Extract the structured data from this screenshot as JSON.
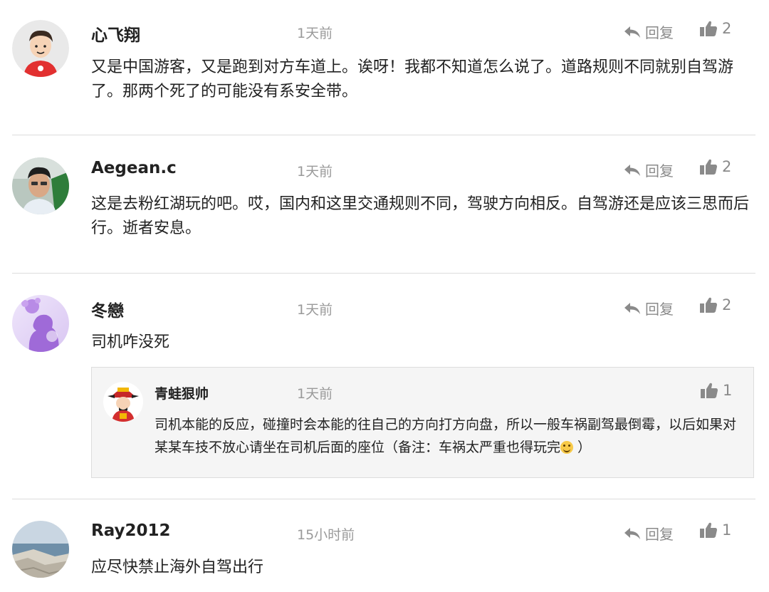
{
  "comments": [
    {
      "username": "心飞翔",
      "time": "1天前",
      "reply_label": "回复",
      "likes": "2",
      "text": "又是中国游客，又是跑到对方车道上。诶呀！我都不知道怎么说了。道路规则不同就别自驾游了。那两个死了的可能没有系安全带。"
    },
    {
      "username": "Aegean.c",
      "time": "1天前",
      "reply_label": "回复",
      "likes": "2",
      "text": "这是去粉红湖玩的吧。哎，国内和这里交通规则不同，驾驶方向相反。自驾游还是应该三思而后行。逝者安息。"
    },
    {
      "username": "冬戀",
      "time": "1天前",
      "reply_label": "回复",
      "likes": "2",
      "text": "司机咋没死",
      "reply": {
        "username": "青蛙狠帅",
        "time": "1天前",
        "likes": "1",
        "text_before_emoji": "司机本能的反应，碰撞时会本能的往自己的方向打方向盘，所以一般车祸副驾最倒霉，以后如果对某某车技不放心请坐在司机后面的座位（备注：车祸太严重也得玩完",
        "emoji_name": "grin-emoji",
        "text_after_emoji": " ）"
      }
    },
    {
      "username": "Ray2012",
      "time": "15小时前",
      "reply_label": "回复",
      "likes": "1",
      "text": "应尽快禁止海外自驾出行"
    }
  ],
  "icons": {
    "reply": "reply-arrow-icon",
    "like": "thumbs-up-icon"
  },
  "colors": {
    "meta_gray": "#9a9a9a",
    "action_gray": "#8a8a8a",
    "divider": "#dcdcdc",
    "reply_bg": "#f5f5f5"
  }
}
